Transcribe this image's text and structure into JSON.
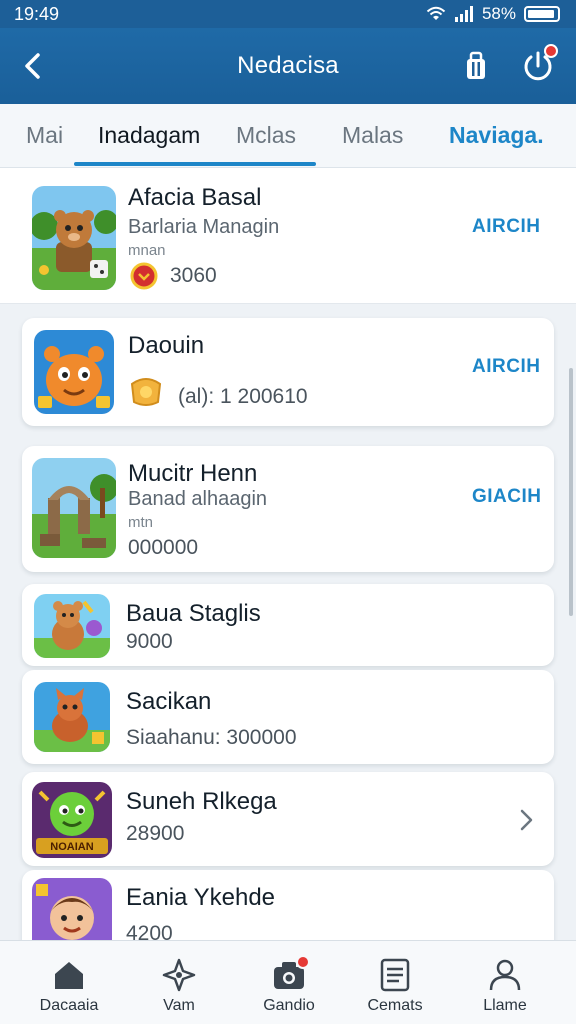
{
  "status_bar": {
    "time": "19:49",
    "battery": "58%"
  },
  "header": {
    "title": "Nedacisa",
    "back_icon": "chevron-left-icon",
    "bag_icon": "shopping-bag-icon",
    "power_icon": "power-icon"
  },
  "tabs": [
    {
      "label": "Mai"
    },
    {
      "label": "Inadagam"
    },
    {
      "label": "Mclas"
    },
    {
      "label": "Malas"
    },
    {
      "label": "Naviaga."
    }
  ],
  "list": [
    {
      "name": "Afacia Basal",
      "subtitle": "Barlaria Managin",
      "tiny": "mnan",
      "amount": "3060",
      "action": "AIRCIH",
      "thumb_icon": "bear-game-icon",
      "coin_icon": "red-coin-icon"
    },
    {
      "name": "Daouin",
      "subtitle": "",
      "tiny": "",
      "amount": "(al): 1 200610",
      "action": "AIRCIH",
      "thumb_icon": "orange-creature-game-icon",
      "coin_icon": "gold-coin-icon"
    },
    {
      "name": "Mucitr Henn",
      "subtitle": "Banad alhaagin",
      "tiny": "mtn",
      "amount": "000000",
      "action": "GIACIH",
      "thumb_icon": "stone-arch-game-icon",
      "coin_icon": ""
    },
    {
      "name": "Baua Staglis",
      "subtitle": "",
      "tiny": "",
      "amount": "9000",
      "action": "",
      "thumb_icon": "bear-gem-game-icon",
      "coin_icon": ""
    },
    {
      "name": "Sacikan",
      "subtitle": "",
      "tiny": "",
      "amount": "Siaahanu: 300000",
      "action": "",
      "thumb_icon": "fox-game-icon",
      "coin_icon": ""
    },
    {
      "name": "Suneh Rlkega",
      "subtitle": "",
      "tiny": "",
      "amount": "28900",
      "action": "",
      "thumb_icon": "green-monster-game-icon",
      "coin_icon": "",
      "thumb_caption": "NOAIAN"
    },
    {
      "name": "Eania Ykehde",
      "subtitle": "",
      "tiny": "",
      "amount": "4200",
      "action": "",
      "thumb_icon": "kid-game-icon",
      "coin_icon": ""
    }
  ],
  "bottom_nav": [
    {
      "label": "Dacaaia",
      "icon": "home-icon"
    },
    {
      "label": "Vam",
      "icon": "star-compass-icon"
    },
    {
      "label": "Gandio",
      "icon": "camera-icon"
    },
    {
      "label": "Cemats",
      "icon": "document-icon"
    },
    {
      "label": "Llame",
      "icon": "person-icon"
    }
  ],
  "colors": {
    "header": "#1d5f98",
    "accent": "#1d86c8",
    "badge": "#e53935"
  }
}
